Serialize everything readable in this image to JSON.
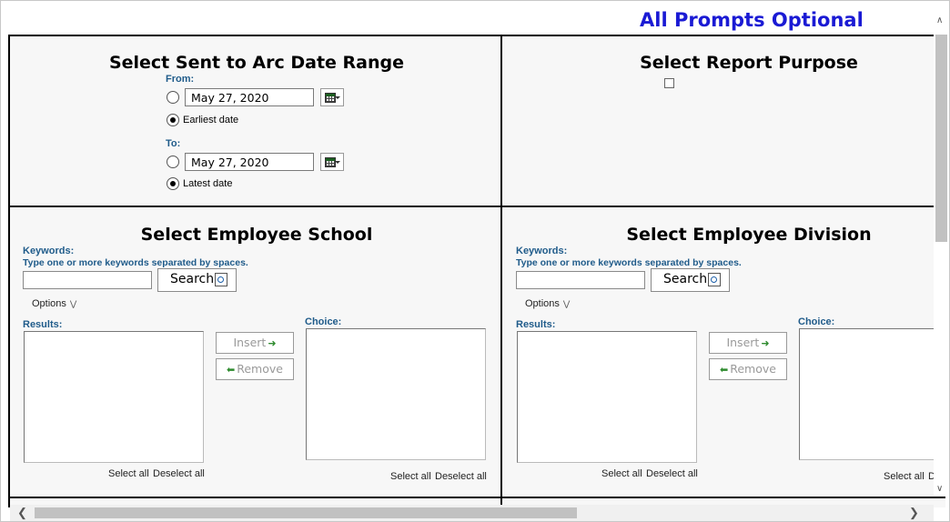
{
  "header": {
    "title": "All Prompts Optional"
  },
  "date_panel": {
    "title": "Select Sent to Arc Date Range",
    "from_label": "From:",
    "from_value": "May 27, 2020",
    "from_default_option": "Earliest date",
    "to_label": "To:",
    "to_value": "May 27, 2020",
    "to_default_option": "Latest date"
  },
  "purpose_panel": {
    "title": "Select Report Purpose"
  },
  "school_panel": {
    "title": "Select Employee School",
    "keywords_label": "Keywords:",
    "keywords_hint": "Type one or more keywords separated by spaces.",
    "keywords_value": "",
    "search_label": "Search",
    "options_label": "Options",
    "results_label": "Results:",
    "choice_label": "Choice:",
    "insert_label": "Insert",
    "remove_label": "Remove",
    "select_all": "Select all",
    "deselect_all": "Deselect all"
  },
  "division_panel": {
    "title": "Select Employee Division",
    "keywords_label": "Keywords:",
    "keywords_hint": "Type one or more keywords separated by spaces.",
    "keywords_value": "",
    "search_label": "Search",
    "options_label": "Options",
    "results_label": "Results:",
    "choice_label": "Choice:",
    "insert_label": "Insert",
    "remove_label": "Remove",
    "select_all": "Select all",
    "deselect_all": "Deselect all"
  },
  "icons": {
    "calendar": "calendar-icon",
    "search": "magnifier-icon",
    "options": "chevron-down-icon",
    "insert": "arrow-right-icon",
    "remove": "arrow-left-icon"
  },
  "colors": {
    "header_title": "#1a1ad4",
    "label_blue": "#1f5b8a",
    "arrow_green": "#2e8b2e",
    "panel_bg": "#f7f7f7",
    "grid_line": "#000000"
  }
}
